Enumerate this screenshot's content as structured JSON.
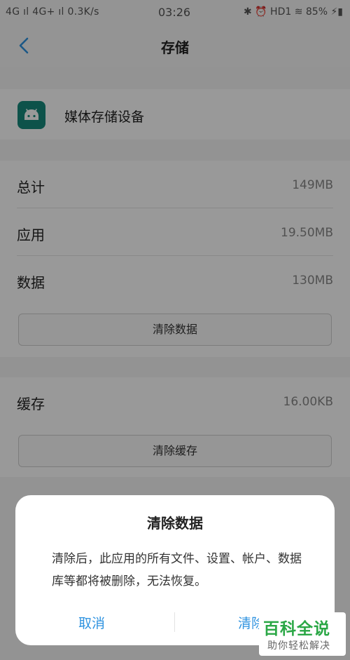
{
  "status_bar": {
    "left_text": "4G ıl  4G+ ıl  0.3K/s",
    "time": "03:26",
    "right_text": "✱ ⏰ HD1 ≋ 85% ⚡▮"
  },
  "header": {
    "title": "存储",
    "back_icon": "chevron-left-icon"
  },
  "app": {
    "name": "媒体存储设备",
    "icon": "android-icon",
    "icon_color": "#16897c"
  },
  "storage": {
    "rows": [
      {
        "label": "总计",
        "value": "149MB"
      },
      {
        "label": "应用",
        "value": "19.50MB"
      },
      {
        "label": "数据",
        "value": "130MB"
      }
    ],
    "clear_data_button": "清除数据"
  },
  "cache": {
    "label": "缓存",
    "value": "16.00KB",
    "clear_cache_button": "清除缓存"
  },
  "dialog": {
    "title": "清除数据",
    "message": "清除后，此应用的所有文件、设置、帐户、数据库等都将被删除，无法恢复。",
    "cancel_label": "取消",
    "confirm_label": "清除"
  },
  "watermark": {
    "main": "百科全说",
    "sub": "助你轻松解决"
  },
  "colors": {
    "accent": "#2f93e0",
    "watermark_green": "#2aa745"
  }
}
